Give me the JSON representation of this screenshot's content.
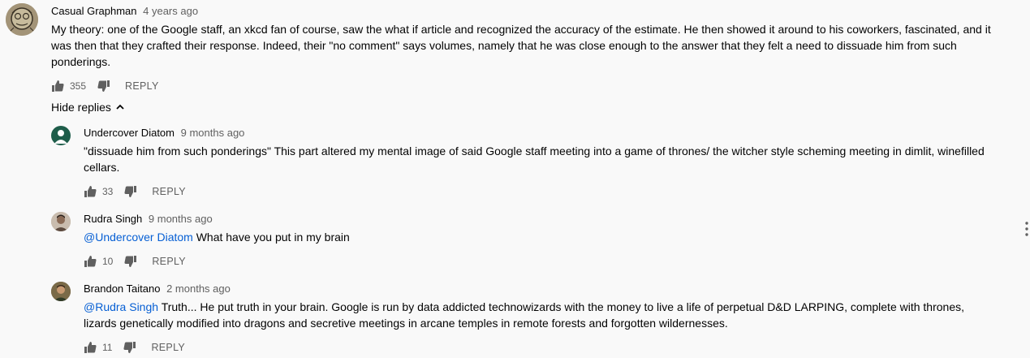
{
  "top_comment": {
    "author": "Casual Graphman",
    "time": "4 years ago",
    "text": "My theory: one of the Google staff, an xkcd fan of course, saw the what if article and recognized the accuracy of the estimate. He then showed it around to his coworkers, fascinated, and it was then that they crafted their response. Indeed, their \"no comment\" says volumes, namely that he was close enough to the answer that they felt a need to dissuade him from such ponderings.",
    "likes": "355",
    "reply_label": "REPLY"
  },
  "hide_replies_label": "Hide replies",
  "replies": [
    {
      "author": "Undercover Diatom",
      "time": "9 months ago",
      "mention": "",
      "text": "\"dissuade him from such ponderings\" This part altered my mental image of said Google staff meeting into a game of thrones/ the witcher style scheming meeting in dimlit, winefilled cellars.",
      "likes": "33",
      "reply_label": "REPLY"
    },
    {
      "author": "Rudra Singh",
      "time": "9 months ago",
      "mention": "@Undercover Diatom",
      "text": "What have you put in my brain",
      "likes": "10",
      "reply_label": "REPLY"
    },
    {
      "author": "Brandon Taitano",
      "time": "2 months ago",
      "mention": "@Rudra Singh",
      "text": "Truth... He put truth in your brain. Google is run by data addicted technowizards with the money to live a life of perpetual D&D LARPING, complete with thrones, lizards genetically modified into dragons and secretive meetings in arcane temples in remote forests and forgotten wildernesses.",
      "likes": "11",
      "reply_label": "REPLY"
    }
  ],
  "colors": {
    "background": "#f9f9f9",
    "text": "#030303",
    "secondary": "#606060",
    "link": "#065fd4",
    "avatar_diatom": "#1e5d4a"
  },
  "icons": [
    "like-icon",
    "dislike-icon",
    "chevron-up-icon",
    "more-options-icon"
  ]
}
